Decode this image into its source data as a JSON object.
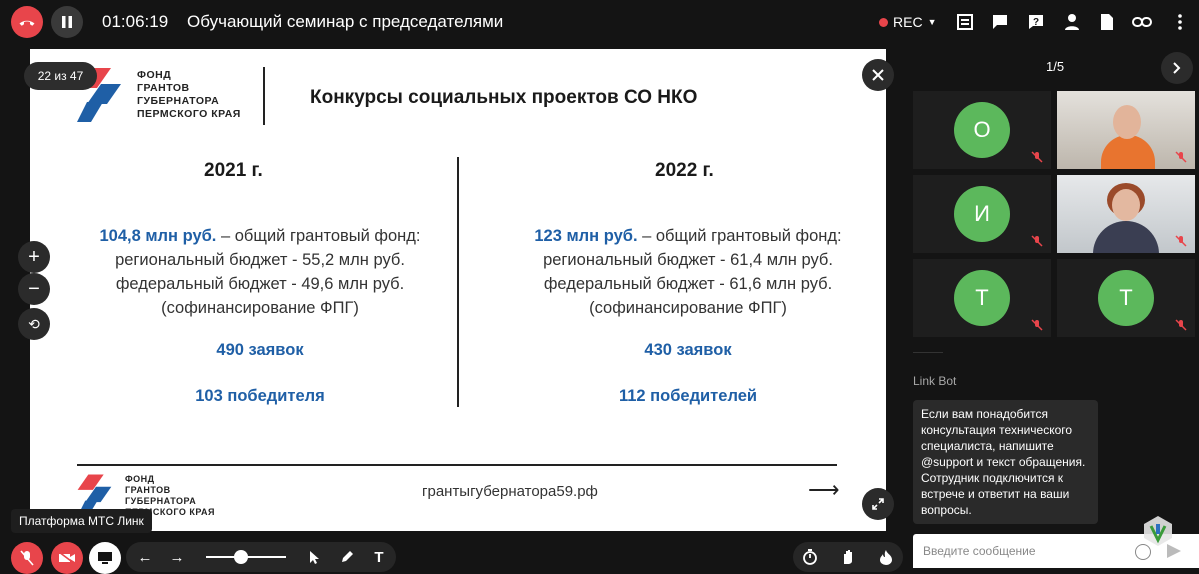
{
  "header": {
    "timer": "01:06:19",
    "title": "Обучающий семинар с председателями",
    "rec_label": "REC"
  },
  "slide": {
    "page_indicator": "22 из 47",
    "logo_lines": [
      "ФОНД",
      "ГРАНТОВ",
      "ГУБЕРНАТОРА",
      "ПЕРМСКОГО КРАЯ"
    ],
    "title": "Конкурсы социальных проектов СО НКО",
    "left": {
      "year": "2021 г.",
      "fund_amount": "104,8 млн руб.",
      "fund_rest": " – общий грантовый фонд:",
      "regional": "региональный бюджет - 55,2 млн руб.",
      "federal": "федеральный бюджет - 49,6 млн руб.",
      "cofinancing": "(софинансирование ФПГ)",
      "applications": "490 заявок",
      "winners": "103 победителя"
    },
    "right": {
      "year": "2022 г.",
      "fund_amount": "123 млн руб.",
      "fund_rest": " – общий грантовый фонд:",
      "regional": "региональный бюджет - 61,4 млн руб.",
      "federal": "федеральный бюджет - 61,6 млн руб.",
      "cofinancing": "(софинансирование ФПГ)",
      "applications": "430 заявок",
      "winners": "112 победителей"
    },
    "website": "грантыгубернатора59.рф",
    "arrow": "⟶"
  },
  "tooltip": "Платформа МТС Линк",
  "sidebar": {
    "pager": "1/5",
    "tiles": [
      {
        "initial": "О"
      },
      {
        "initial": ""
      },
      {
        "initial": "И"
      },
      {
        "initial": ""
      },
      {
        "initial": "Т"
      },
      {
        "initial": "Т"
      }
    ],
    "bot_name": "Link Bot",
    "bot_message": "Если вам понадобится консультация технического специалиста, напишите @support и текст обращения. Сотрудник подключится к встрече и ответит на ваши вопросы.",
    "input_placeholder": "Введите сообщение"
  },
  "colors": {
    "accent_red": "#e8454b",
    "slide_blue": "#1f5fa6",
    "avatar_green": "#5cb85c"
  }
}
